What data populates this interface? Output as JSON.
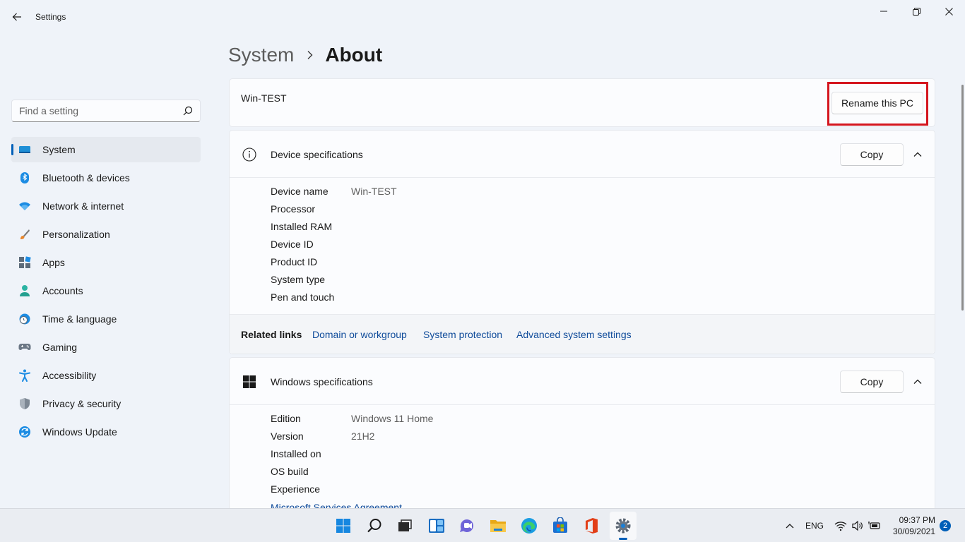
{
  "window": {
    "app_title": "Settings"
  },
  "search": {
    "placeholder": "Find a setting",
    "value": ""
  },
  "sidebar": {
    "items": [
      {
        "label": "System",
        "icon": "system-icon",
        "active": true
      },
      {
        "label": "Bluetooth & devices",
        "icon": "bluetooth-icon"
      },
      {
        "label": "Network & internet",
        "icon": "network-icon"
      },
      {
        "label": "Personalization",
        "icon": "personalization-icon"
      },
      {
        "label": "Apps",
        "icon": "apps-icon"
      },
      {
        "label": "Accounts",
        "icon": "accounts-icon"
      },
      {
        "label": "Time & language",
        "icon": "time-language-icon"
      },
      {
        "label": "Gaming",
        "icon": "gaming-icon"
      },
      {
        "label": "Accessibility",
        "icon": "accessibility-icon"
      },
      {
        "label": "Privacy & security",
        "icon": "privacy-shield-icon"
      },
      {
        "label": "Windows Update",
        "icon": "windows-update-icon"
      }
    ]
  },
  "breadcrumb": {
    "parent": "System",
    "current": "About"
  },
  "pc": {
    "name": "Win-TEST",
    "rename_label": "Rename this PC"
  },
  "device_specs": {
    "title": "Device specifications",
    "copy_label": "Copy",
    "rows": [
      {
        "key": "Device name",
        "value": "Win-TEST"
      },
      {
        "key": "Processor",
        "value": ""
      },
      {
        "key": "Installed RAM",
        "value": ""
      },
      {
        "key": "Device ID",
        "value": ""
      },
      {
        "key": "Product ID",
        "value": ""
      },
      {
        "key": "System type",
        "value": ""
      },
      {
        "key": "Pen and touch",
        "value": ""
      }
    ]
  },
  "related_links": {
    "label": "Related links",
    "links": [
      "Domain or workgroup",
      "System protection",
      "Advanced system settings"
    ]
  },
  "windows_specs": {
    "title": "Windows specifications",
    "copy_label": "Copy",
    "rows": [
      {
        "key": "Edition",
        "value": "Windows 11 Home"
      },
      {
        "key": "Version",
        "value": "21H2"
      },
      {
        "key": "Installed on",
        "value": ""
      },
      {
        "key": "OS build",
        "value": ""
      },
      {
        "key": "Experience",
        "value": ""
      }
    ],
    "agreement_link": "Microsoft Services Agreement"
  },
  "taskbar": {
    "apps": [
      "start-icon",
      "search-icon",
      "task-view-icon",
      "widgets-icon",
      "chat-icon",
      "file-explorer-icon",
      "edge-icon",
      "store-icon",
      "office-icon",
      "settings-icon"
    ],
    "language": "ENG",
    "time": "09:37 PM",
    "date": "30/09/2021",
    "notification_count": "2"
  },
  "colors": {
    "accent": "#005fb8",
    "highlight": "#d4161f",
    "link": "#0f4b9a"
  }
}
